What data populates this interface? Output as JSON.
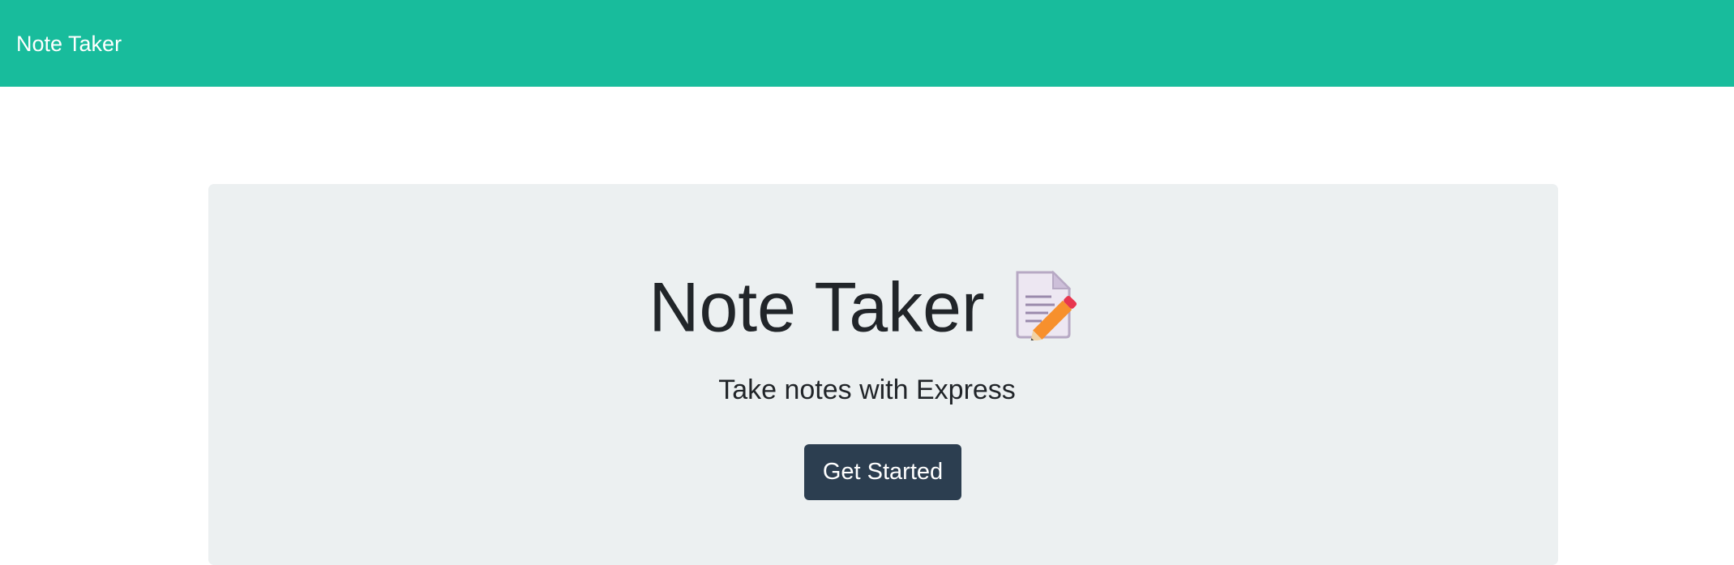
{
  "navbar": {
    "brand": "Note Taker",
    "background_color": "#18bc9c"
  },
  "hero": {
    "title": "Note Taker",
    "title_icon": "memo-icon",
    "subtitle": "Take notes with Express",
    "cta_label": "Get Started",
    "cta_color": "#2c3e50",
    "panel_color": "#ecf0f1"
  }
}
